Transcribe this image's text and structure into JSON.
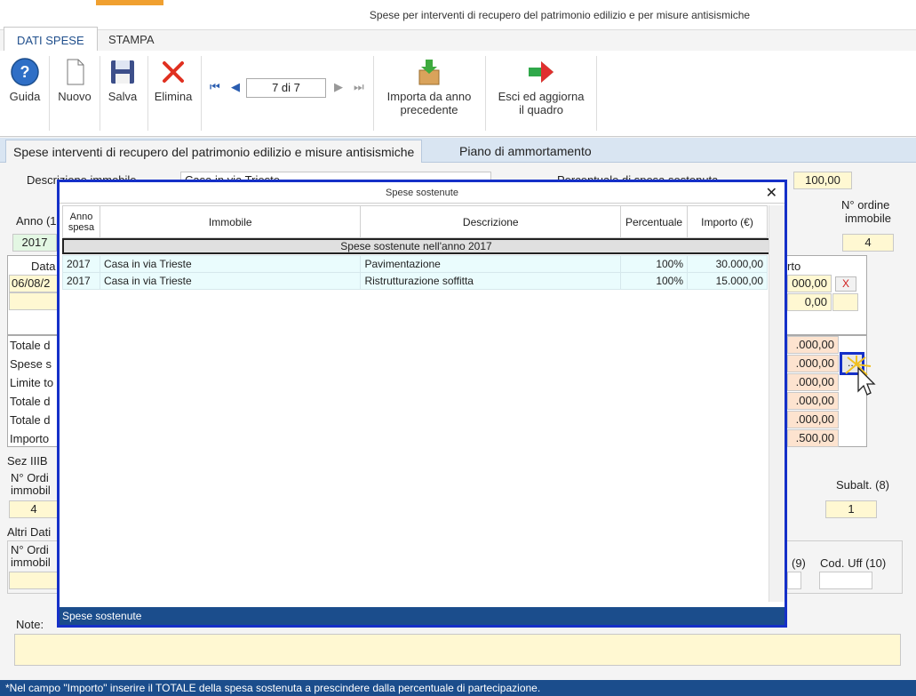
{
  "window": {
    "title": "Spese per interventi di recupero del patrimonio edilizio e per misure antisismiche"
  },
  "ribbon_tabs": [
    "DATI SPESE",
    "STAMPA"
  ],
  "toolbar": {
    "guida": "Guida",
    "nuovo": "Nuovo",
    "salva": "Salva",
    "elimina": "Elimina",
    "pager": "7 di 7",
    "importa_line1": "Importa da anno",
    "importa_line2": "precedente",
    "esci_line1": "Esci ed aggiorna",
    "esci_line2": "il quadro"
  },
  "section_tabs": [
    "Spese interventi di recupero del patrimonio edilizio e misure antisismiche",
    "Piano di ammortamento"
  ],
  "form": {
    "descrizione_label": "Descrizione immobile",
    "descrizione_value": "Casa in via Trieste",
    "percentuale_label": "Percentuale di spesa sostenuta",
    "percentuale_value": "100,00",
    "anno_label": "Anno (1",
    "anno_value": "2017",
    "ordine_label_1": "N° ordine",
    "ordine_label_2": "immobile",
    "ordine_value": "4",
    "data_label": "Data",
    "data_value": "06/08/2",
    "importo_label": "rto",
    "importo_row1": "000,00",
    "importo_row2": "0,00",
    "delete_mark": "X",
    "totale_rows": [
      {
        "label": "Totale d",
        "value": ".000,00"
      },
      {
        "label": "Spese s",
        "value": ".000,00"
      },
      {
        "label": "Limite to",
        "value": ".000,00"
      },
      {
        "label": "Totale d",
        "value": ".000,00"
      },
      {
        "label": "Totale d",
        "value": ".000,00"
      },
      {
        "label": "Importo",
        "value": ".500,00"
      }
    ],
    "dots_button": "...",
    "sez_label": "Sez IIIB",
    "ordine2_label_1": "N° Ordi",
    "ordine2_label_2": "immobil",
    "ordine2_value": "4",
    "subalt_label": "Subalt.",
    "subalt_num": "(8)",
    "subalt_value": "1",
    "altri_label": "Altri Dati",
    "ordine3_label_1": "N° Ordi",
    "ordine3_label_2": "immobil",
    "col9_label": "(9)",
    "coduff_label": "Cod. Uff",
    "coduff_num": "(10)",
    "note_label": "Note:"
  },
  "modal": {
    "title": "Spese sostenute",
    "columns": [
      "Anno spesa",
      "Immobile",
      "Descrizione",
      "Percentuale",
      "Importo (€)"
    ],
    "group_label": "Spese sostenute nell'anno 2017",
    "rows": [
      {
        "anno": "2017",
        "immobile": "Casa in via Trieste",
        "descrizione": "Pavimentazione",
        "percentuale": "100%",
        "importo": "30.000,00"
      },
      {
        "anno": "2017",
        "immobile": "Casa in via Trieste",
        "descrizione": "Ristrutturazione soffitta",
        "percentuale": "100%",
        "importo": "15.000,00"
      }
    ],
    "status": "Spese sostenute"
  },
  "footer": {
    "text": "*Nel campo \"Importo\" inserire il TOTALE della spesa sostenuta a prescindere dalla percentuale di partecipazione."
  },
  "colors": {
    "accent_blue": "#1b4d8c",
    "modal_border": "#1530c8",
    "field_yellow": "#fff8d2",
    "field_peach": "#fde3cf"
  }
}
